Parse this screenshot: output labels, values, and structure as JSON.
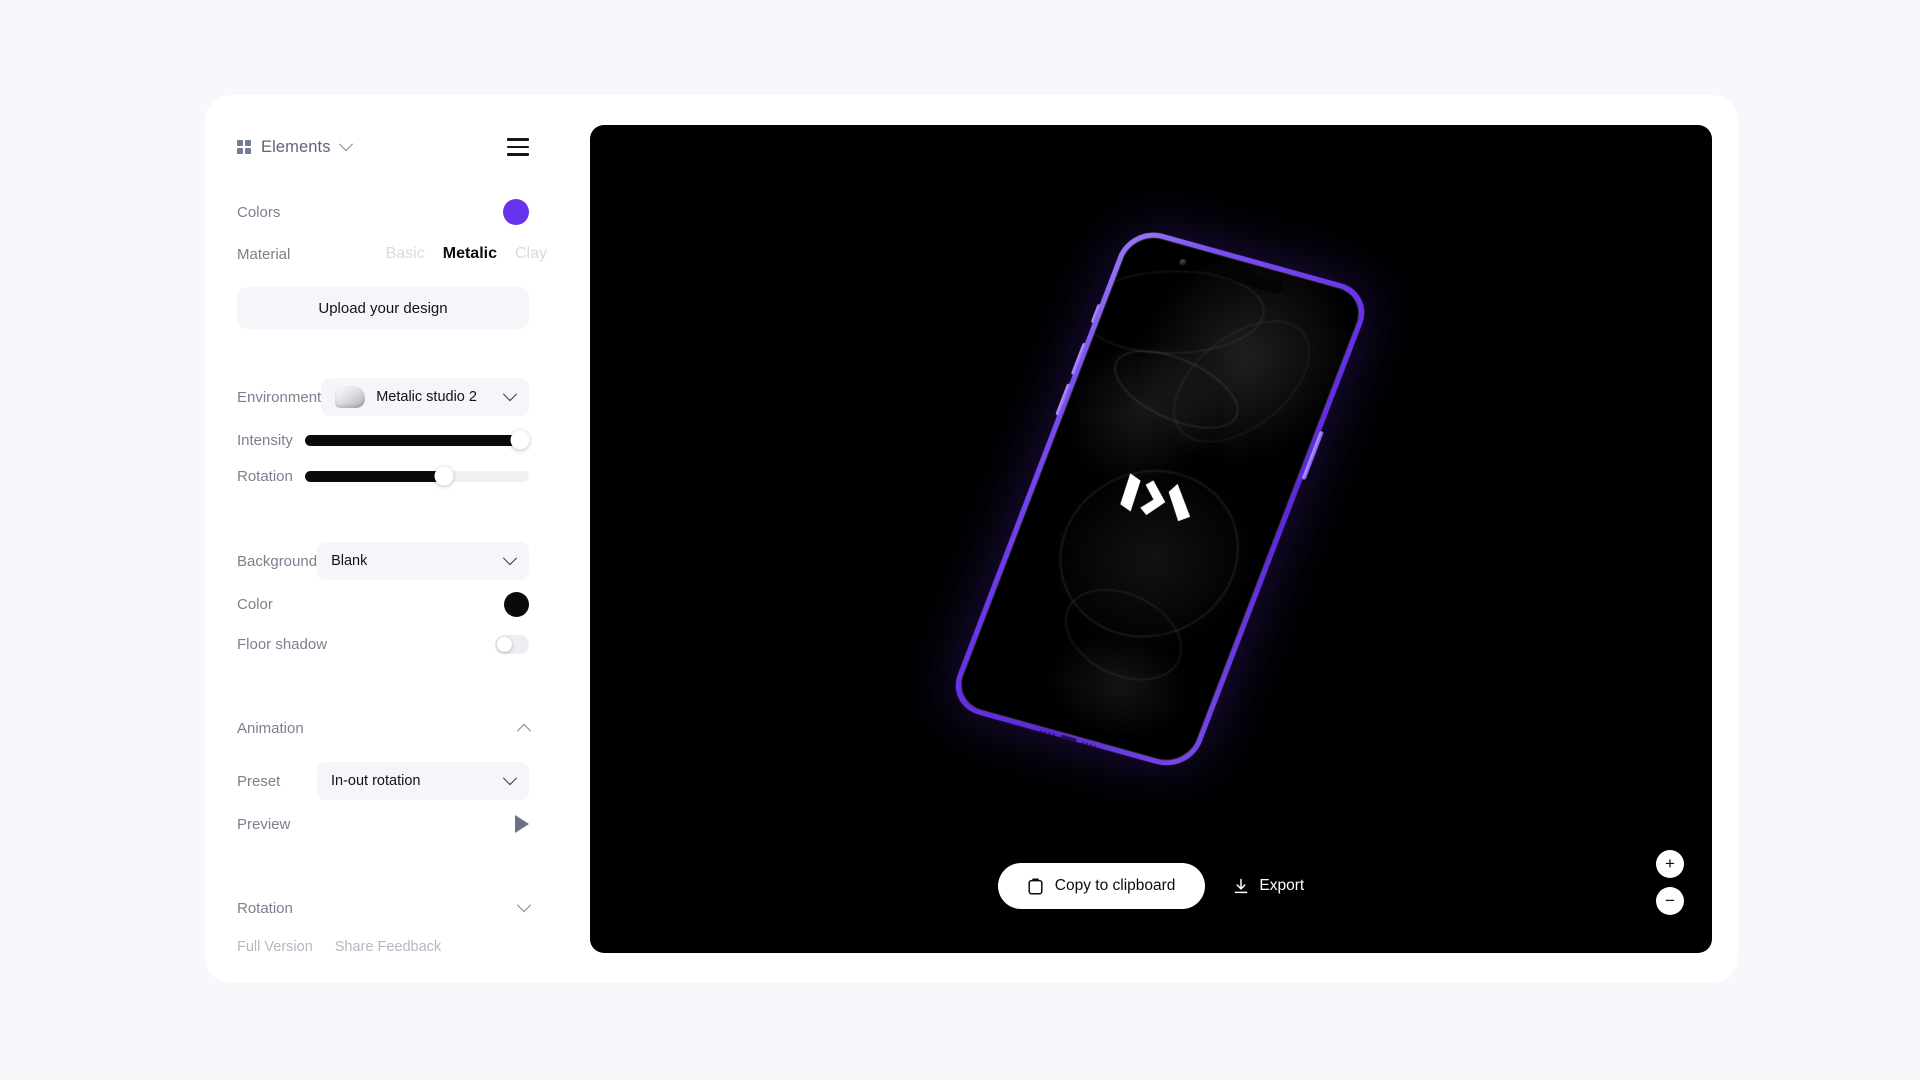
{
  "sidebar": {
    "elements_label": "Elements",
    "menu_icon": "hamburger-icon",
    "grid_icon": "grid-icon",
    "colors": {
      "label": "Colors",
      "swatch_color": "#6633ee"
    },
    "material": {
      "label": "Material",
      "options": [
        "Basic",
        "Metalic",
        "Clay"
      ],
      "selected": "Metalic"
    },
    "upload_button": "Upload your design",
    "environment": {
      "label": "Environment",
      "value": "Metalic studio 2"
    },
    "intensity": {
      "label": "Intensity",
      "value": 96
    },
    "rotation_slider": {
      "label": "Rotation",
      "value": 62
    },
    "background": {
      "label": "Background",
      "value": "Blank"
    },
    "color": {
      "label": "Color",
      "swatch_color": "#0a0a0a"
    },
    "floor_shadow": {
      "label": "Floor shadow",
      "enabled": false
    },
    "animation": {
      "label": "Animation",
      "expanded": true,
      "preset_label": "Preset",
      "preset_value": "In-out rotation",
      "preview_label": "Preview"
    },
    "rotation_section": {
      "label": "Rotation",
      "expanded": false
    },
    "footer": {
      "full_version": "Full Version",
      "share_feedback": "Share Feedback"
    }
  },
  "viewport": {
    "background_color": "#000000",
    "copy_button": "Copy to clipboard",
    "export_button": "Export",
    "zoom_in": "+",
    "zoom_out": "−"
  }
}
